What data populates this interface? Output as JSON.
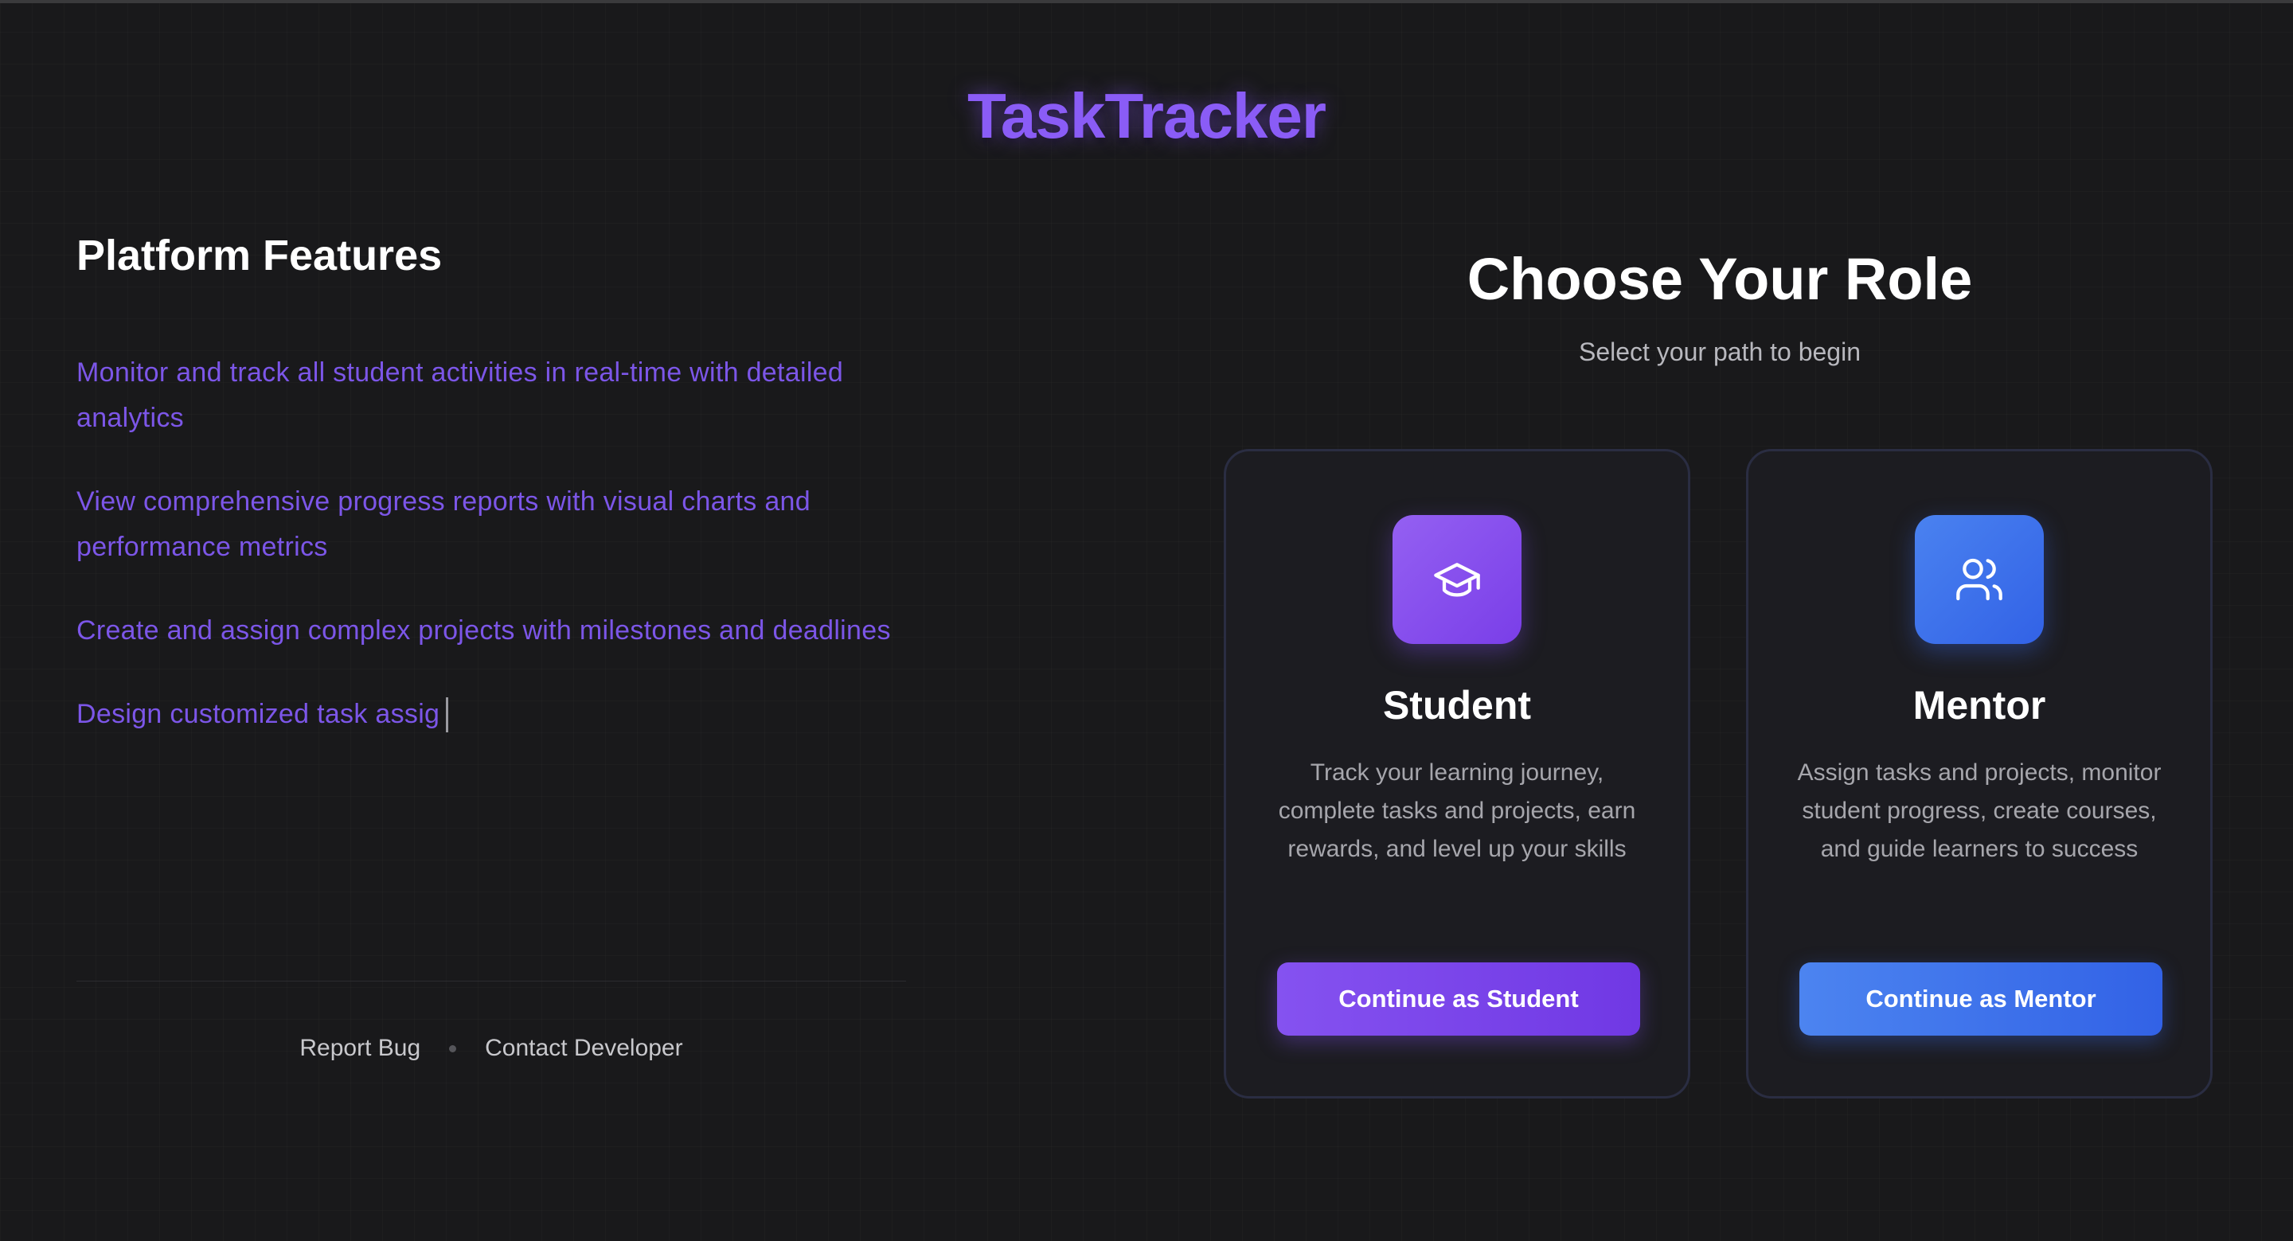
{
  "app": {
    "logo": "TaskTracker"
  },
  "features": {
    "title": "Platform Features",
    "items": [
      "Monitor and track all student activities in real-time with detailed analytics",
      "View comprehensive progress reports with visual charts and performance metrics",
      "Create and assign complex projects with milestones and deadlines",
      "Design customized task assig"
    ]
  },
  "footer": {
    "report_bug": "Report Bug",
    "contact_developer": "Contact Developer"
  },
  "roles": {
    "title": "Choose Your Role",
    "subtitle": "Select your path to begin",
    "student": {
      "icon": "graduation-cap-icon",
      "title": "Student",
      "description": "Track your learning journey, complete tasks and projects, earn rewards, and level up your skills",
      "button": "Continue as Student",
      "accent": "#8552f0"
    },
    "mentor": {
      "icon": "users-icon",
      "title": "Mentor",
      "description": "Assign tasks and projects, monitor student progress, create courses, and guide learners to success",
      "button": "Continue as Mentor",
      "accent": "#3f72ec"
    }
  }
}
